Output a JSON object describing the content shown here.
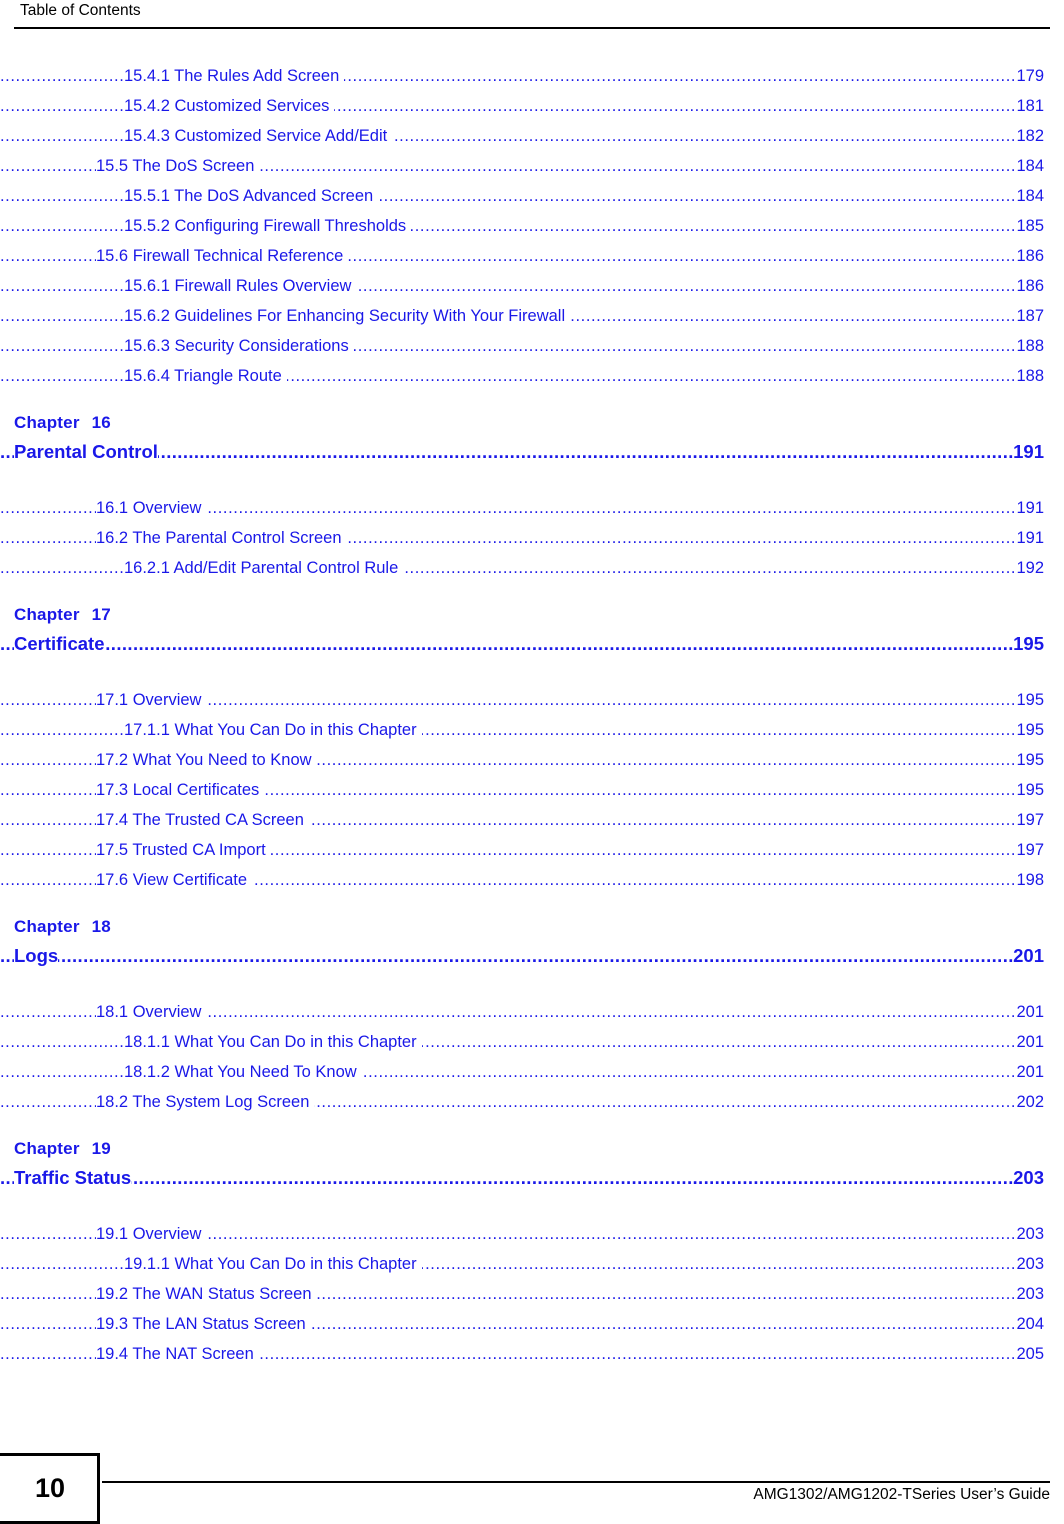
{
  "header": {
    "running_title": "Table of Contents"
  },
  "toc": {
    "groups": [
      {
        "type": "entries",
        "entries": [
          {
            "level": 3,
            "title": "15.4.1 The Rules Add Screen ",
            "page": "179"
          },
          {
            "level": 3,
            "title": "15.4.2 Customized Services  ",
            "page": "181"
          },
          {
            "level": 3,
            "title": "15.4.3 Customized Service Add/Edit  ",
            "page": "182"
          },
          {
            "level": 2,
            "title": "15.5 The DoS Screen ",
            "page": "184"
          },
          {
            "level": 3,
            "title": "15.5.1 The DoS Advanced Screen ",
            "page": "184"
          },
          {
            "level": 3,
            "title": "15.5.2 Configuring Firewall Thresholds ",
            "page": "185"
          },
          {
            "level": 2,
            "title": "15.6 Firewall Technical Reference ",
            "page": "186"
          },
          {
            "level": 3,
            "title": "15.6.1 Firewall Rules Overview ",
            "page": "186"
          },
          {
            "level": 3,
            "title": "15.6.2 Guidelines For Enhancing Security With Your Firewall ",
            "page": "187"
          },
          {
            "level": 3,
            "title": "15.6.3 Security Considerations ",
            "page": "188"
          },
          {
            "level": 3,
            "title": "15.6.4 Triangle Route ",
            "page": "188"
          }
        ]
      },
      {
        "type": "chapter",
        "chapter_word": "Chapter",
        "chapter_number": "16",
        "chapter_title": "Parental Control",
        "page": "191",
        "entries": [
          {
            "level": 2,
            "title": "16.1 Overview ",
            "page": "191"
          },
          {
            "level": 2,
            "title": "16.2 The Parental Control Screen ",
            "page": "191"
          },
          {
            "level": 3,
            "title": "16.2.1 Add/Edit Parental Control Rule ",
            "page": "192"
          }
        ]
      },
      {
        "type": "chapter",
        "chapter_word": "Chapter",
        "chapter_number": "17",
        "chapter_title": "Certificate ",
        "page": "195",
        "entries": [
          {
            "level": 2,
            "title": "17.1 Overview ",
            "page": "195"
          },
          {
            "level": 3,
            "title": "17.1.1 What You Can Do in this Chapter ",
            "page": "195"
          },
          {
            "level": 2,
            "title": "17.2 What You Need to Know ",
            "page": "195"
          },
          {
            "level": 2,
            "title": "17.3 Local Certificates ",
            "page": "195"
          },
          {
            "level": 2,
            "title": "17.4 The Trusted CA Screen  ",
            "page": "197"
          },
          {
            "level": 2,
            "title": "17.5 Trusted CA Import   ",
            "page": "197"
          },
          {
            "level": 2,
            "title": "17.6 View Certificate ",
            "page": "198"
          }
        ]
      },
      {
        "type": "chapter",
        "chapter_word": "Chapter",
        "chapter_number": "18",
        "chapter_title": "Logs ",
        "page": "201",
        "entries": [
          {
            "level": 2,
            "title": "18.1 Overview  ",
            "page": "201"
          },
          {
            "level": 3,
            "title": "18.1.1 What You Can Do in this Chapter ",
            "page": "201"
          },
          {
            "level": 3,
            "title": "18.1.2 What You Need To Know ",
            "page": "201"
          },
          {
            "level": 2,
            "title": "18.2 The System Log Screen ",
            "page": "202"
          }
        ]
      },
      {
        "type": "chapter",
        "chapter_word": "Chapter",
        "chapter_number": "19",
        "chapter_title": "Traffic Status ",
        "page": "203",
        "entries": [
          {
            "level": 2,
            "title": "19.1 Overview ",
            "page": "203"
          },
          {
            "level": 3,
            "title": "19.1.1 What You Can Do in this Chapter ",
            "page": "203"
          },
          {
            "level": 2,
            "title": "19.2 The WAN Status Screen ",
            "page": "203"
          },
          {
            "level": 2,
            "title": "19.3 The LAN Status Screen ",
            "page": "204"
          },
          {
            "level": 2,
            "title": "19.4 The NAT Screen ",
            "page": "205"
          }
        ]
      }
    ]
  },
  "footer": {
    "page_number": "10",
    "guide_title": "AMG1302/AMG1202-TSeries User’s Guide"
  },
  "colors": {
    "link_blue": "#1a18e8",
    "text_black": "#000000",
    "background": "#ffffff"
  }
}
